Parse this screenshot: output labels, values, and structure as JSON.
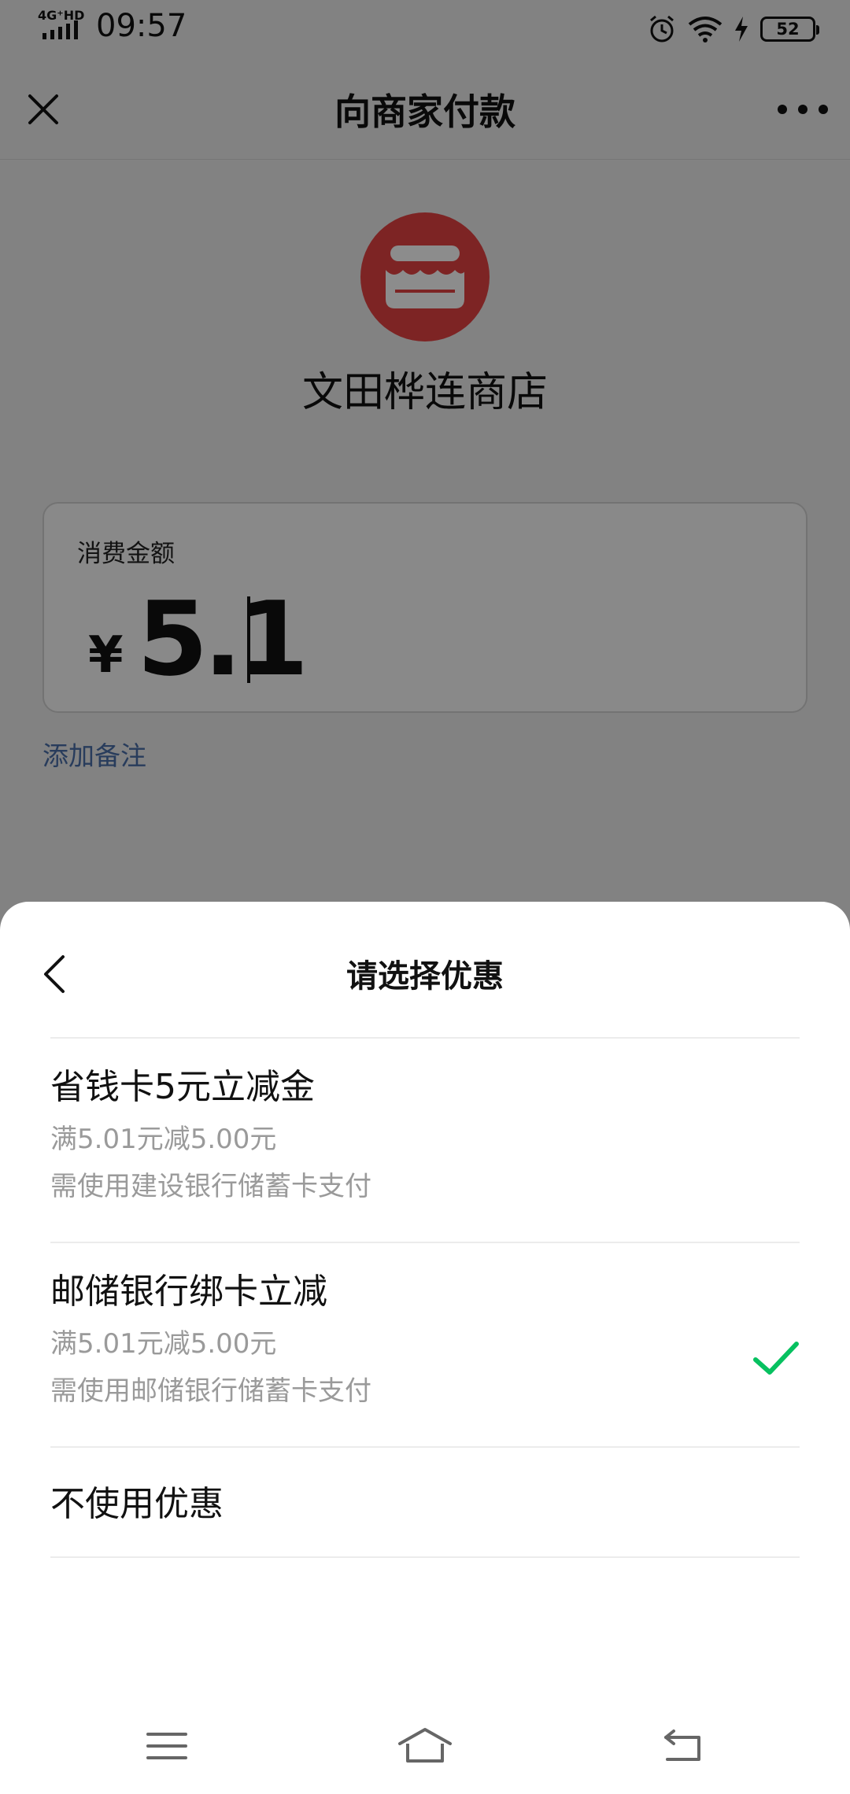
{
  "status_bar": {
    "network": "4G⁺HD",
    "time": "09:57",
    "battery": "52"
  },
  "header": {
    "title": "向商家付款"
  },
  "merchant": {
    "name": "文田桦连商店"
  },
  "amount": {
    "label": "消费金额",
    "currency": "¥",
    "value": "5.1"
  },
  "note_link": "添加备注",
  "discount_sheet": {
    "title": "请选择优惠",
    "options": [
      {
        "title": "省钱卡5元立减金",
        "condition": "满5.01元减5.00元",
        "requirement": "需使用建设银行储蓄卡支付",
        "selected": false
      },
      {
        "title": "邮储银行绑卡立减",
        "condition": "满5.01元减5.00元",
        "requirement": "需使用邮储银行储蓄卡支付",
        "selected": true
      },
      {
        "title": "不使用优惠",
        "selected": false
      }
    ]
  },
  "colors": {
    "accent_green": "#07c160",
    "link_blue": "#4a6ea8",
    "merchant_red": "#e44343"
  }
}
